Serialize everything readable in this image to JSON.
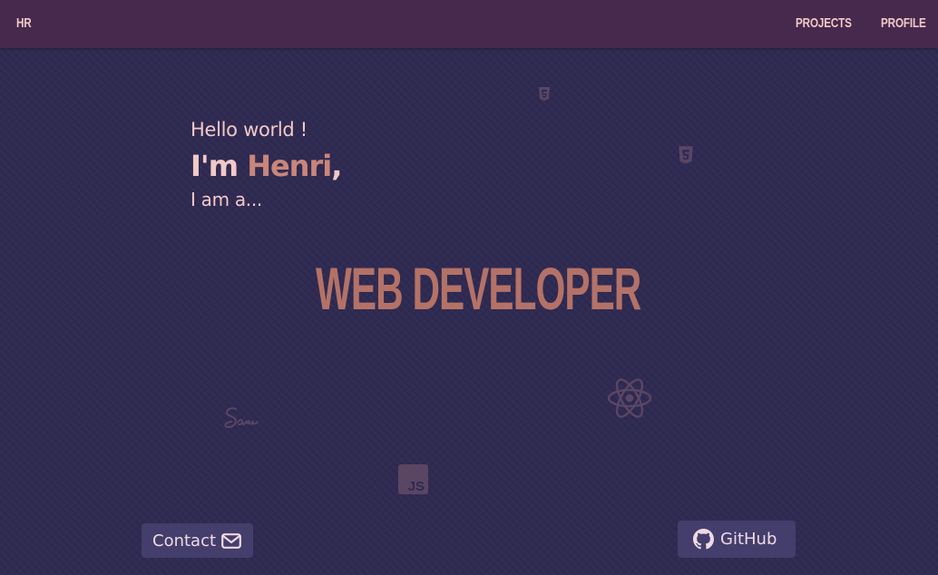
{
  "navbar": {
    "brand": "HR",
    "links": [
      {
        "label": "PROJECTS"
      },
      {
        "label": "PROFILE"
      }
    ]
  },
  "hero": {
    "greeting": "Hello world !",
    "intro_prefix": "I'm",
    "name": "Henri",
    "comma": ",",
    "role_intro": "I am a...",
    "role": "WEB DEVELOPER"
  },
  "decorations": {
    "icons": [
      "html5-icon",
      "css3-icon",
      "react-icon",
      "sass-icon",
      "javascript-icon"
    ]
  },
  "buttons": {
    "contact": {
      "label": "Contact",
      "icon": "envelope-icon"
    },
    "github": {
      "label": "GitHub",
      "icon": "github-icon"
    }
  },
  "colors": {
    "background": "#2f2a52",
    "navbar": "#46294c",
    "text_light": "#f2c9c8",
    "accent": "#c9867a",
    "role": "#b47267",
    "button": "#433e6b"
  }
}
